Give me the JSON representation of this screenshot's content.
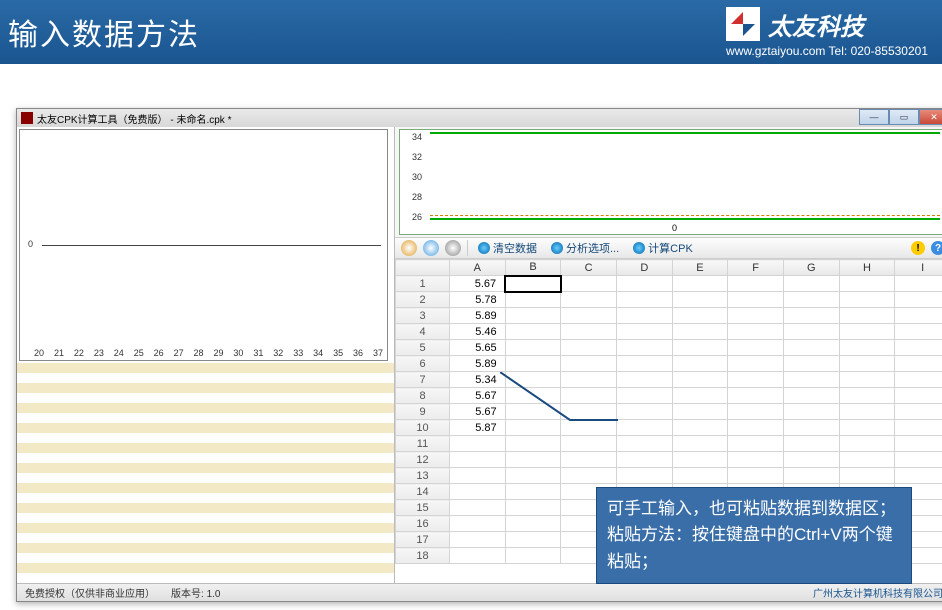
{
  "header": {
    "title": "输入数据方法",
    "brand": "太友科技",
    "url": "www.gztaiyou.com",
    "tel_label": "Tel:",
    "tel": "020-85530201"
  },
  "window": {
    "title": "太友CPK计算工具（免费版） - 未命名.cpk *"
  },
  "chart_left": {
    "y_zero": "0",
    "x_ticks": [
      "20",
      "21",
      "22",
      "23",
      "24",
      "25",
      "26",
      "27",
      "28",
      "29",
      "30",
      "31",
      "32",
      "33",
      "34",
      "35",
      "36",
      "37"
    ]
  },
  "chart_right": {
    "y_ticks": [
      "34",
      "32",
      "30",
      "28",
      "26"
    ],
    "x_zero": "0"
  },
  "toolbar": {
    "clear": "清空数据",
    "options": "分析选项...",
    "calc": "计算CPK"
  },
  "grid": {
    "columns": [
      "",
      "A",
      "B",
      "C",
      "D",
      "E",
      "F",
      "G",
      "H",
      "I"
    ],
    "rows": [
      {
        "n": "1",
        "A": "5.67"
      },
      {
        "n": "2",
        "A": "5.78"
      },
      {
        "n": "3",
        "A": "5.89"
      },
      {
        "n": "4",
        "A": "5.46"
      },
      {
        "n": "5",
        "A": "5.65"
      },
      {
        "n": "6",
        "A": "5.89"
      },
      {
        "n": "7",
        "A": "5.34"
      },
      {
        "n": "8",
        "A": "5.67"
      },
      {
        "n": "9",
        "A": "5.67"
      },
      {
        "n": "10",
        "A": "5.87"
      },
      {
        "n": "11",
        "A": ""
      },
      {
        "n": "12",
        "A": ""
      },
      {
        "n": "13",
        "A": ""
      },
      {
        "n": "14",
        "A": ""
      },
      {
        "n": "15",
        "A": ""
      },
      {
        "n": "16",
        "A": ""
      },
      {
        "n": "17",
        "A": ""
      },
      {
        "n": "18",
        "A": ""
      }
    ],
    "selected": {
      "row": 0,
      "col": "B"
    }
  },
  "status": {
    "copyright": "免费授权（仅供非商业应用）",
    "version_label": "版本号:",
    "version": "1.0",
    "company": "广州太友计算机科技有限公司"
  },
  "callout": {
    "line1": "可手工输入，也可粘贴数据到数据区；",
    "line2": "粘贴方法：按住键盘中的Ctrl+V两个键粘贴；"
  },
  "chart_data": {
    "type": "line",
    "left_chart": {
      "xlim": [
        20,
        37
      ],
      "y_zero": 0,
      "series": []
    },
    "right_chart": {
      "ylim": [
        26,
        34
      ],
      "x_zero": 0,
      "series": []
    }
  }
}
